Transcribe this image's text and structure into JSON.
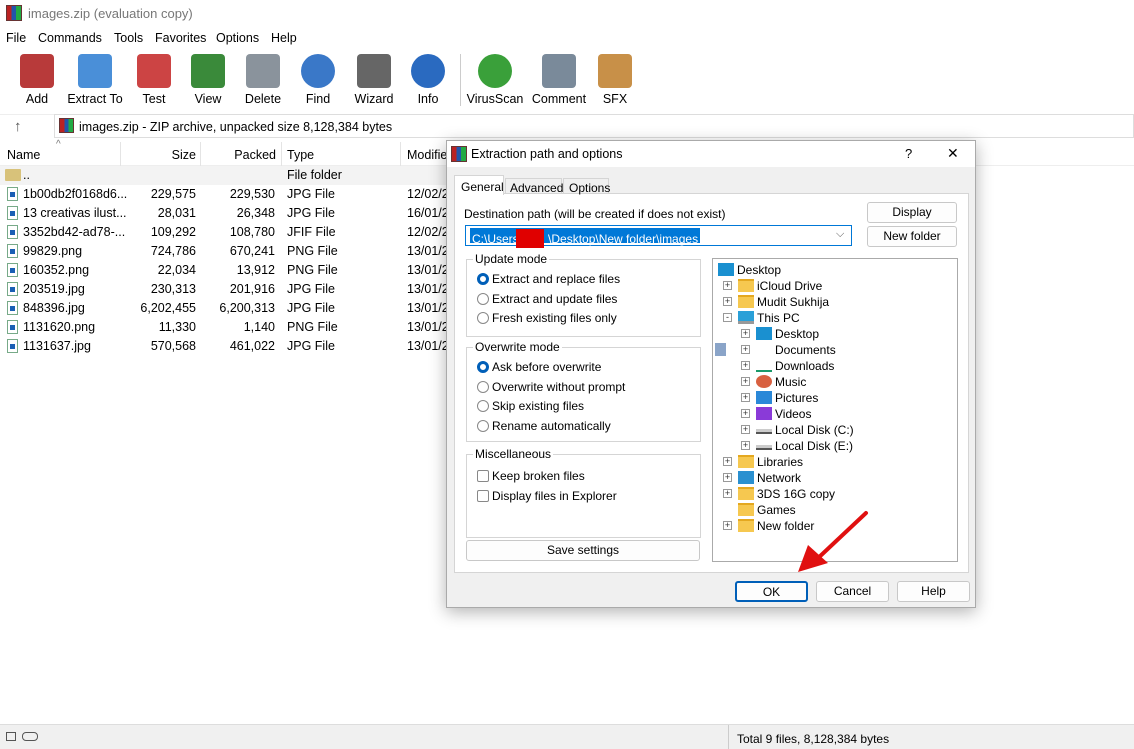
{
  "window": {
    "title": "images.zip (evaluation copy)"
  },
  "menu": [
    "File",
    "Commands",
    "Tools",
    "Favorites",
    "Options",
    "Help"
  ],
  "toolbar": [
    {
      "label": "Add",
      "icon": "archive-add-icon",
      "color": "#b83a3a"
    },
    {
      "label": "Extract To",
      "icon": "folder-extract-icon",
      "color": "#4a8fd8"
    },
    {
      "label": "Test",
      "icon": "clipboard-check-icon",
      "color": "#c44"
    },
    {
      "label": "View",
      "icon": "book-view-icon",
      "color": "#3a8a3a"
    },
    {
      "label": "Delete",
      "icon": "trash-icon",
      "color": "#8a939c"
    },
    {
      "label": "Find",
      "icon": "magnifier-icon",
      "color": "#3a78c8"
    },
    {
      "label": "Wizard",
      "icon": "magic-wand-icon",
      "color": "#666"
    },
    {
      "label": "Info",
      "icon": "info-icon",
      "color": "#2a6ac0"
    },
    {
      "label": "VirusScan",
      "icon": "bug-scan-icon",
      "color": "#3aa03a"
    },
    {
      "label": "Comment",
      "icon": "comment-icon",
      "color": "#7a8a9a"
    },
    {
      "label": "SFX",
      "icon": "sfx-box-icon",
      "color": "#c89048"
    }
  ],
  "address": {
    "text": "images.zip - ZIP archive, unpacked size 8,128,384 bytes"
  },
  "list": {
    "columns": [
      "Name",
      "Size",
      "Packed",
      "Type",
      "Modified"
    ],
    "parent": {
      "name": "..",
      "type": "File folder"
    },
    "rows": [
      {
        "name": "1b00db2f0168d6...",
        "size": "229,575",
        "packed": "229,530",
        "type": "JPG File",
        "modified": "12/02/2"
      },
      {
        "name": "13 creativas ilust...",
        "size": "28,031",
        "packed": "26,348",
        "type": "JPG File",
        "modified": "16/01/2"
      },
      {
        "name": "3352bd42-ad78-...",
        "size": "109,292",
        "packed": "108,780",
        "type": "JFIF File",
        "modified": "12/02/2"
      },
      {
        "name": "99829.png",
        "size": "724,786",
        "packed": "670,241",
        "type": "PNG File",
        "modified": "13/01/2"
      },
      {
        "name": "160352.png",
        "size": "22,034",
        "packed": "13,912",
        "type": "PNG File",
        "modified": "13/01/2"
      },
      {
        "name": "203519.jpg",
        "size": "230,313",
        "packed": "201,916",
        "type": "JPG File",
        "modified": "13/01/2"
      },
      {
        "name": "848396.jpg",
        "size": "6,202,455",
        "packed": "6,200,313",
        "type": "JPG File",
        "modified": "13/01/2"
      },
      {
        "name": "1131620.png",
        "size": "11,330",
        "packed": "1,140",
        "type": "PNG File",
        "modified": "13/01/2"
      },
      {
        "name": "1131637.jpg",
        "size": "570,568",
        "packed": "461,022",
        "type": "JPG File",
        "modified": "13/01/2"
      }
    ]
  },
  "status": {
    "total": "Total 9 files, 8,128,384 bytes"
  },
  "dialog": {
    "title": "Extraction path and options",
    "help": "?",
    "close": "✕",
    "tabs": [
      "General",
      "Advanced",
      "Options"
    ],
    "active_tab": "General",
    "dest_label": "Destination path (will be created if does not exist)",
    "dest_prefix": "C:\\Users\\",
    "dest_suffix": "\\Desktop\\New folder\\images",
    "display": "Display",
    "new_folder": "New folder",
    "update_mode": {
      "title": "Update mode",
      "options": [
        "Extract and replace files",
        "Extract and update files",
        "Fresh existing files only"
      ],
      "selected": 0
    },
    "overwrite_mode": {
      "title": "Overwrite mode",
      "options": [
        "Ask before overwrite",
        "Overwrite without prompt",
        "Skip existing files",
        "Rename automatically"
      ],
      "selected": 0
    },
    "misc": {
      "title": "Miscellaneous",
      "options": [
        "Keep broken files",
        "Display files in Explorer"
      ],
      "checked": [
        false,
        false
      ]
    },
    "save_settings": "Save settings",
    "tree": [
      {
        "label": "Desktop",
        "level": 0,
        "exp": "",
        "icon": "desktop"
      },
      {
        "label": "iCloud Drive",
        "level": 1,
        "exp": "+",
        "icon": "folder"
      },
      {
        "label": "Mudit Sukhija",
        "level": 1,
        "exp": "+",
        "icon": "folder"
      },
      {
        "label": "This PC",
        "level": 1,
        "exp": "-",
        "icon": "pc"
      },
      {
        "label": "Desktop",
        "level": 2,
        "exp": "+",
        "icon": "desktop"
      },
      {
        "label": "Documents",
        "level": 2,
        "exp": "+",
        "icon": "documents"
      },
      {
        "label": "Downloads",
        "level": 2,
        "exp": "+",
        "icon": "downloads"
      },
      {
        "label": "Music",
        "level": 2,
        "exp": "+",
        "icon": "music"
      },
      {
        "label": "Pictures",
        "level": 2,
        "exp": "+",
        "icon": "pictures"
      },
      {
        "label": "Videos",
        "level": 2,
        "exp": "+",
        "icon": "videos"
      },
      {
        "label": "Local Disk (C:)",
        "level": 2,
        "exp": "+",
        "icon": "disk"
      },
      {
        "label": "Local Disk (E:)",
        "level": 2,
        "exp": "+",
        "icon": "disk"
      },
      {
        "label": "Libraries",
        "level": 1,
        "exp": "+",
        "icon": "folder"
      },
      {
        "label": "Network",
        "level": 1,
        "exp": "+",
        "icon": "network"
      },
      {
        "label": "3DS 16G copy",
        "level": 1,
        "exp": "+",
        "icon": "folder"
      },
      {
        "label": "Games",
        "level": 1,
        "exp": "",
        "icon": "folder"
      },
      {
        "label": "New folder",
        "level": 1,
        "exp": "+",
        "icon": "folder"
      }
    ],
    "ok": "OK",
    "cancel": "Cancel",
    "help_btn": "Help"
  },
  "colors": {
    "accent": "#005fb8",
    "selection": "#0078d7",
    "annotation_arrow": "#e01010",
    "redaction": "#e00000"
  }
}
